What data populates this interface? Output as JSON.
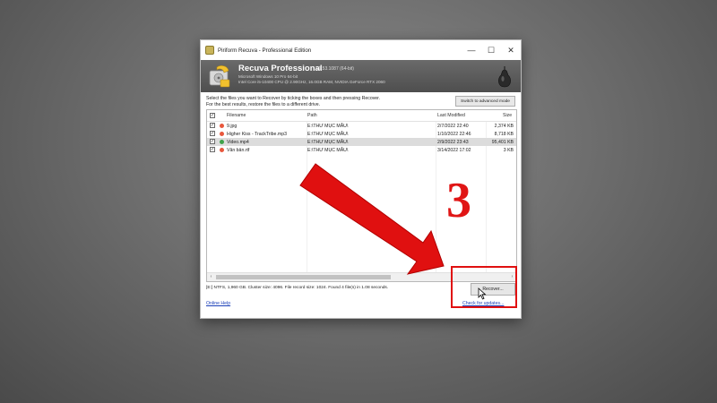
{
  "window": {
    "title": "Piriform Recuva - Professional Edition",
    "controls": {
      "minimize": "—",
      "maximize": "☐",
      "close": "✕"
    }
  },
  "header": {
    "product_name": "Recuva Professional",
    "version": "v1.53.1087 (64-bit)",
    "sysinfo_line1": "Microsoft Windows 10 Pro 64-bit",
    "sysinfo_line2": "Intel Core i5-10400 CPU @ 2.90GHz, 16.0GB RAM, NVIDIA GeForce RTX 2060"
  },
  "instructions": {
    "line1": "Select the files you want to Recover by ticking the boxes and then pressing Recover.",
    "line2": "For the best results, restore the files to a different drive."
  },
  "advanced_mode_label": "Switch to advanced mode",
  "table": {
    "headers": {
      "filename": "Filename",
      "path": "Path",
      "modified": "Last Modified",
      "size": "Size"
    },
    "rows": [
      {
        "filename": "9.jpg",
        "path": "E:\\THƯ MỤC MẪU\\",
        "modified": "2/7/2022 22:40",
        "size": "2,374 KB",
        "checked": "✓",
        "status_color": "#e8573c"
      },
      {
        "filename": "Higher Kiss - TrackTribe.mp3",
        "path": "E:\\THƯ MỤC MẪU\\",
        "modified": "1/10/2022 22:46",
        "size": "8,718 KB",
        "checked": "✓",
        "status_color": "#e8573c"
      },
      {
        "filename": "Video.mp4",
        "path": "E:\\THƯ MỤC MẪU\\",
        "modified": "2/9/2022 23:43",
        "size": "95,401 KB",
        "checked": "✓",
        "status_color": "#3fa34a"
      },
      {
        "filename": "Văn bản.rtf",
        "path": "E:\\THƯ MỤC MẪU\\",
        "modified": "3/14/2022 17:02",
        "size": "3 KB",
        "checked": "✓",
        "status_color": "#e8573c"
      }
    ]
  },
  "scroll": {
    "left_arrow": "‹",
    "right_arrow": "›"
  },
  "status_text": "[E:] NTFS, 1,960 GB. Cluster size: 4096. File record size: 1024. Found 4 file(s) in 1.08 seconds.",
  "recover_label": "Recover...",
  "online_help_label": "Online Help",
  "check_updates_label": "Check for updates...",
  "annotation": {
    "step_number": "3",
    "accent_color": "#e01010"
  }
}
